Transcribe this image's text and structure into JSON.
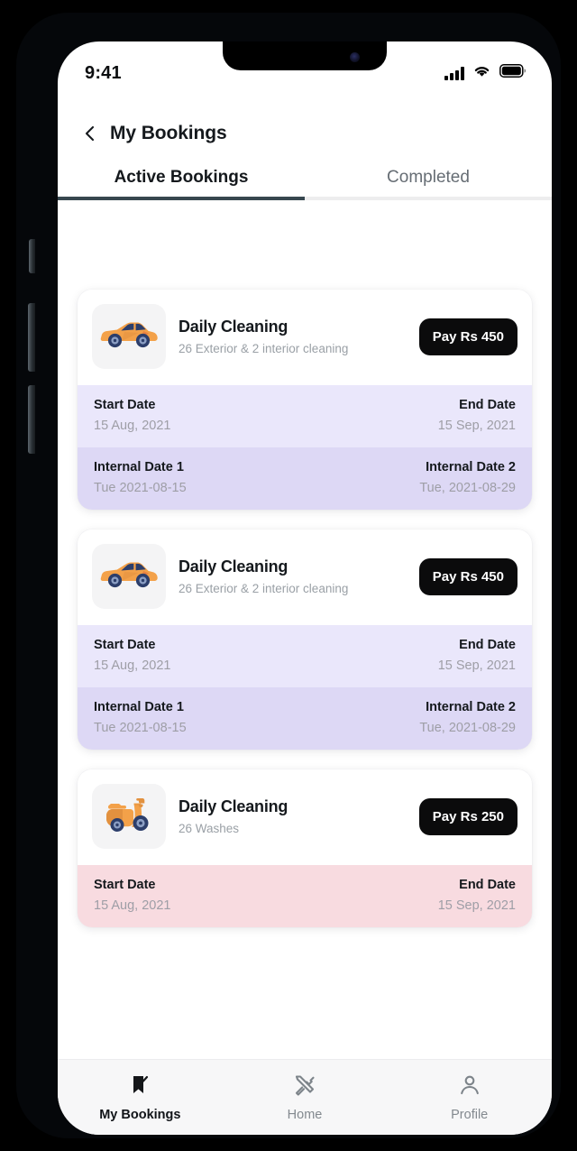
{
  "status_bar": {
    "time": "9:41",
    "signal_icon": "cellular-signal-icon",
    "wifi_icon": "wifi-icon",
    "battery_icon": "battery-full-icon"
  },
  "header": {
    "back_icon": "back-chevron-icon",
    "title": "My Bookings"
  },
  "tabs": [
    {
      "label": "Active Bookings",
      "active": true
    },
    {
      "label": "Completed",
      "active": false
    }
  ],
  "theme": {
    "accent_underline": "#37474f",
    "pay_button_bg": "#0b0b0c",
    "row_primary_bg": "#eae7fb",
    "row_secondary_bg": "#ddd8f5",
    "row_danger_bg": "#f8dbe0",
    "thumb_bg": "#f4f4f5",
    "vehicle_orange": "#f3a149",
    "vehicle_navy": "#2c3e6b"
  },
  "bookings": [
    {
      "vehicle_icon": "car-icon",
      "title": "Daily Cleaning",
      "subtitle": "26 Exterior & 2 interior cleaning",
      "pay_label": "Pay Rs 450",
      "rows": [
        {
          "style": "primary",
          "left_label": "Start Date",
          "left_value": "15 Aug, 2021",
          "right_label": "End Date",
          "right_value": "15 Sep, 2021"
        },
        {
          "style": "secondary",
          "left_label": "Internal Date 1",
          "left_value": "Tue 2021-08-15",
          "right_label": "Internal Date 2",
          "right_value": "Tue, 2021-08-29"
        }
      ]
    },
    {
      "vehicle_icon": "car-icon",
      "title": "Daily Cleaning",
      "subtitle": "26 Exterior & 2 interior cleaning",
      "pay_label": "Pay Rs 450",
      "rows": [
        {
          "style": "primary",
          "left_label": "Start Date",
          "left_value": "15 Aug, 2021",
          "right_label": "End Date",
          "right_value": "15 Sep, 2021"
        },
        {
          "style": "secondary",
          "left_label": "Internal Date 1",
          "left_value": "Tue 2021-08-15",
          "right_label": "Internal Date 2",
          "right_value": "Tue, 2021-08-29"
        }
      ]
    },
    {
      "vehicle_icon": "scooter-icon",
      "title": "Daily Cleaning",
      "subtitle": "26 Washes",
      "pay_label": "Pay Rs 250",
      "rows": [
        {
          "style": "danger",
          "left_label": "Start Date",
          "left_value": "15 Aug, 2021",
          "right_label": "End Date",
          "right_value": "15 Sep, 2021"
        }
      ]
    }
  ],
  "bottom_nav": [
    {
      "label": "My Bookings",
      "icon": "bookmark-check-icon",
      "active": true
    },
    {
      "label": "Home",
      "icon": "tools-icon",
      "active": false
    },
    {
      "label": "Profile",
      "icon": "person-icon",
      "active": false
    }
  ]
}
